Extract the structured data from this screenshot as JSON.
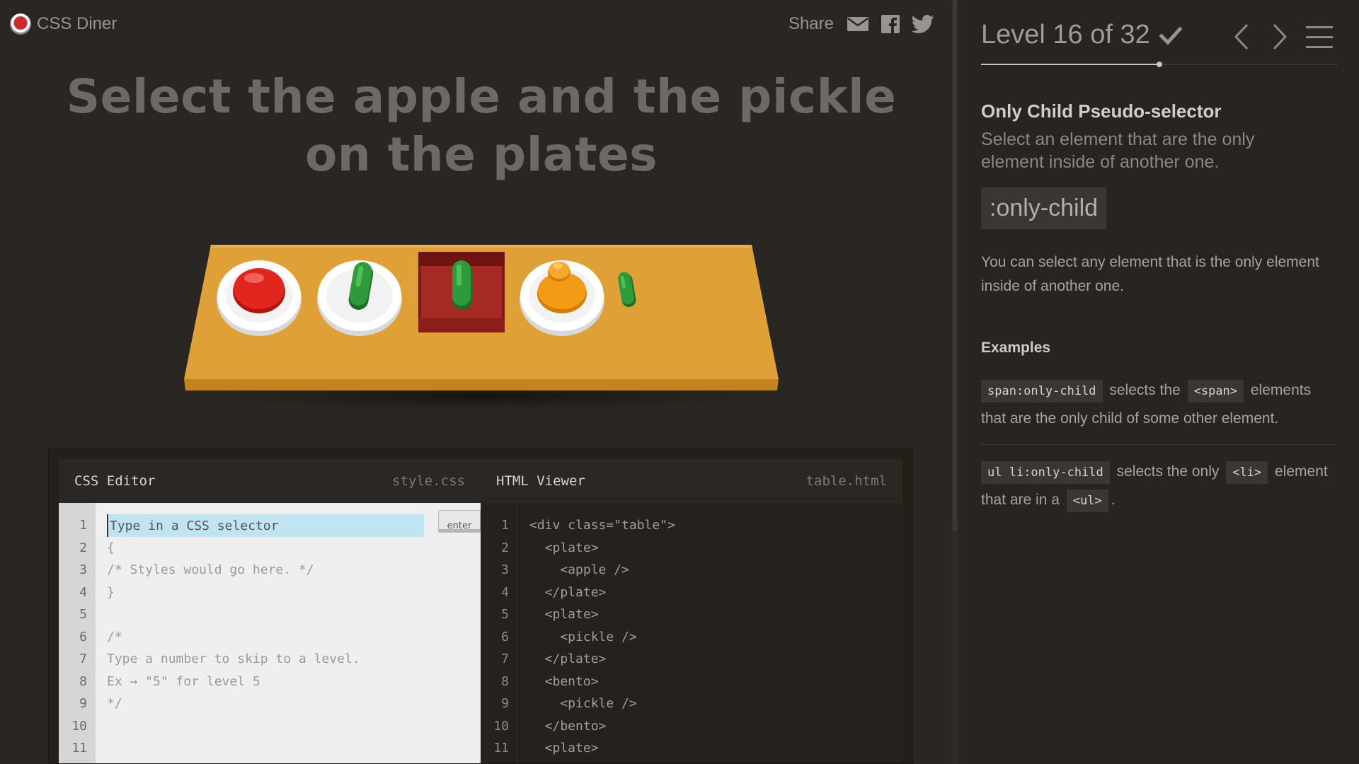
{
  "app": {
    "name": "CSS Diner"
  },
  "share": {
    "label": "Share",
    "icons": [
      "mail-icon",
      "facebook-icon",
      "twitter-icon"
    ]
  },
  "instruction": "Select the apple and the pickle on the plates",
  "table": {
    "items": [
      "plate-apple",
      "plate-pickle",
      "bento-pickle",
      "plate-orange",
      "pickle"
    ]
  },
  "css_editor": {
    "title": "CSS Editor",
    "file": "style.css",
    "placeholder": "Type in a CSS selector",
    "enter_label": "enter",
    "line_numbers": [
      "1",
      "2",
      "3",
      "4",
      "5",
      "6",
      "7",
      "8",
      "9",
      "10",
      "11"
    ],
    "lines": [
      "{",
      "/* Styles would go here. */",
      "}",
      "",
      "/*",
      "Type a number to skip to a level.",
      "Ex → \"5\" for level 5",
      "*/",
      "",
      ""
    ]
  },
  "html_viewer": {
    "title": "HTML Viewer",
    "file": "table.html",
    "line_numbers": [
      "1",
      "2",
      "3",
      "4",
      "5",
      "6",
      "7",
      "8",
      "9",
      "10",
      "11"
    ],
    "lines": [
      "<div class=\"table\">",
      "  <plate>",
      "    <apple />",
      "  </plate>",
      "  <plate>",
      "    <pickle />",
      "  </plate>",
      "  <bento>",
      "    <pickle />",
      "  </bento>",
      "  <plate>"
    ]
  },
  "sidebar": {
    "level_title": "Level 16 of 32",
    "level_completed": true,
    "progress_fraction": 0.5,
    "selector_name": "Only Child Pseudo-selector",
    "selector_subtitle": "Select an element that are the only element inside of another one.",
    "syntax": ":only-child",
    "hint": "You can select any element that is the only element inside of another one.",
    "examples_title": "Examples",
    "examples": [
      {
        "code": "span:only-child",
        "t1": "selects the",
        "tag": "<span>",
        "t2": "elements that are the only child of some other element."
      },
      {
        "code": "ul li:only-child",
        "t1": "selects the only",
        "tag": "<li>",
        "t2": "element that are in a",
        "tag2": "<ul>",
        "t3": "."
      }
    ]
  },
  "colors": {
    "background": "#2a2623",
    "table": "#e0a43a",
    "apple": "#d9231e",
    "pickle": "#2e9a3c",
    "orange": "#f09a1c",
    "bento": "#a62a24"
  }
}
